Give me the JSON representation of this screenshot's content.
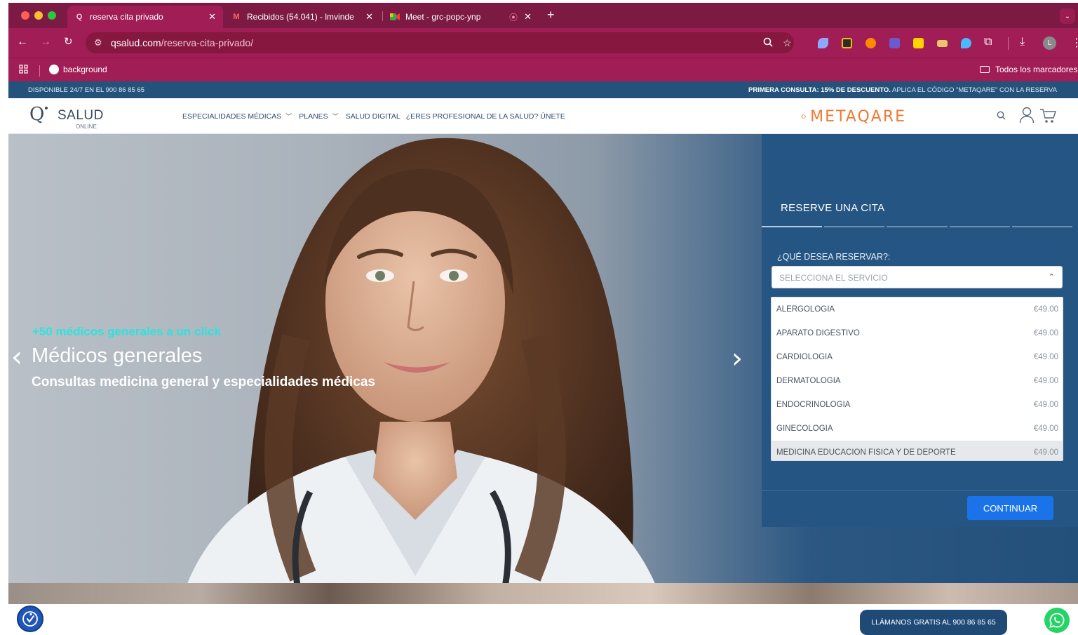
{
  "browser": {
    "tabs": [
      {
        "title": "reserva cita privado",
        "active": true
      },
      {
        "title": "Recibidos (54.041) - lmvinde",
        "active": false
      },
      {
        "title": "Meet - grc-popc-ynp",
        "active": false
      }
    ],
    "url_host": "qsalud.com",
    "url_path": "/reserva-cita-privado/",
    "bookmarks": {
      "left_item": "background",
      "right_item": "Todos los marcadores"
    },
    "colors": {
      "tabstrip": "#7d1a44",
      "toolbar": "#a11d55"
    }
  },
  "site": {
    "topbar": {
      "left": "DISPONIBLE 24/7 EN EL 900 86 85 65",
      "right_bold": "PRIMERA CONSULTA: 15% DE DESCUENTO.",
      "right_rest": " APLICA EL CÓDIGO \"METAQARE\" CON LA RESERVA"
    },
    "logo": {
      "main": "SALUD",
      "tag": "ONLINE"
    },
    "nav": [
      {
        "label": "ESPECIALIDADES MÉDICAS",
        "has_dropdown": true
      },
      {
        "label": "PLANES",
        "has_dropdown": true
      },
      {
        "label": "SALUD DIGITAL",
        "has_dropdown": false
      },
      {
        "label": "¿ERES PROFESIONAL DE LA SALUD? ÚNETE",
        "has_dropdown": false
      }
    ],
    "partner_logo": "METAQARE",
    "hero": {
      "overline": "+50 médicos generales a un click",
      "headline": "Médicos generales",
      "subheadline": "Consultas medicina general y especialidades médicas"
    },
    "booking": {
      "title": "RESERVE UNA CITA",
      "steps_total": 5,
      "step_current": 1,
      "question": "¿QUÉ DESEA RESERVAR?:",
      "select_placeholder": "SELECCIONA EL SERVICIO",
      "options": [
        {
          "name": "ALERGOLOGIA",
          "price": "€49.00"
        },
        {
          "name": "APARATO DIGESTIVO",
          "price": "€49.00"
        },
        {
          "name": "CARDIOLOGIA",
          "price": "€49.00"
        },
        {
          "name": "DERMATOLOGIA",
          "price": "€49.00"
        },
        {
          "name": "ENDOCRINOLOGIA",
          "price": "€49.00"
        },
        {
          "name": "GINECOLOGIA",
          "price": "€49.00"
        },
        {
          "name": "MEDICINA EDUCACION FISICA Y DE DEPORTE",
          "price": "€49.00"
        }
      ],
      "highlighted_option": 6,
      "continue_label": "CONTINUAR"
    },
    "call_button": "LLÁMANOS GRATIS AL 900 86 85 65",
    "colors": {
      "topbar": "#24527a",
      "panel": "#255583",
      "cta": "#1a73e8",
      "overline": "#1ee8e0",
      "whatsapp": "#25d366"
    }
  }
}
